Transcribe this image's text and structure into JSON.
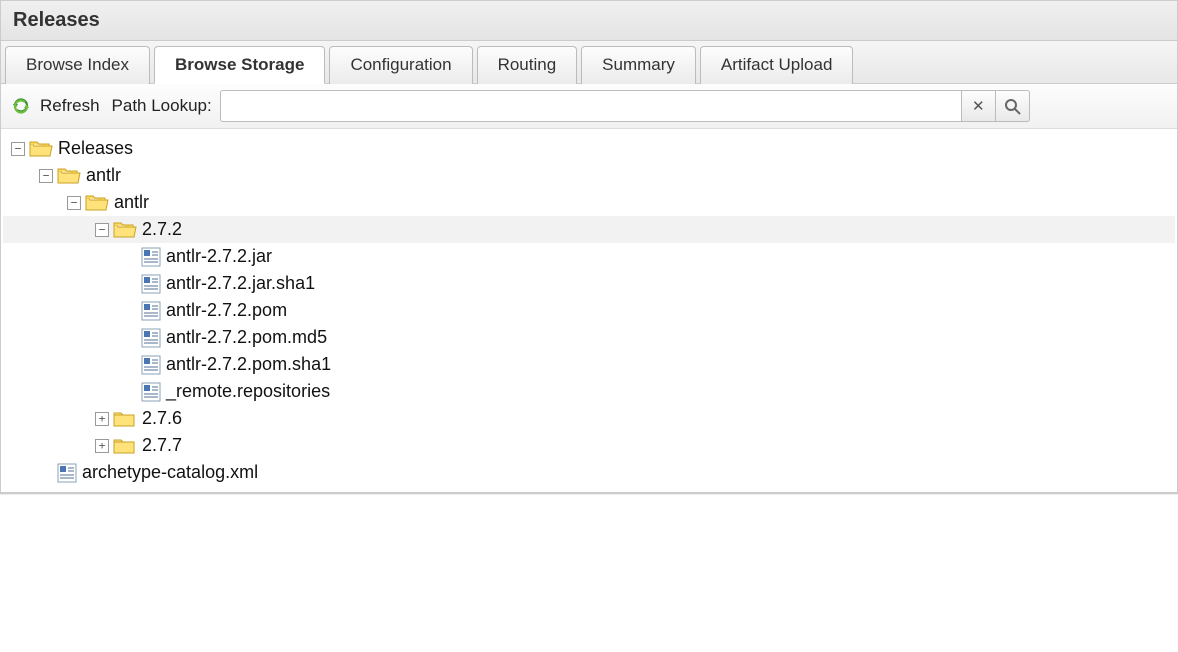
{
  "panel": {
    "title": "Releases"
  },
  "tabs": [
    {
      "label": "Browse Index",
      "active": false
    },
    {
      "label": "Browse Storage",
      "active": true
    },
    {
      "label": "Configuration",
      "active": false
    },
    {
      "label": "Routing",
      "active": false
    },
    {
      "label": "Summary",
      "active": false
    },
    {
      "label": "Artifact Upload",
      "active": false
    }
  ],
  "toolbar": {
    "refresh_label": "Refresh",
    "lookup_label": "Path Lookup:",
    "lookup_value": "",
    "lookup_placeholder": ""
  },
  "tree": [
    {
      "depth": 0,
      "type": "folder-open",
      "toggle": "minus",
      "label": "Releases",
      "selected": false
    },
    {
      "depth": 1,
      "type": "folder-open",
      "toggle": "minus",
      "label": "antlr",
      "selected": false
    },
    {
      "depth": 2,
      "type": "folder-open",
      "toggle": "minus",
      "label": "antlr",
      "selected": false
    },
    {
      "depth": 3,
      "type": "folder-open",
      "toggle": "minus",
      "label": "2.7.2",
      "selected": true
    },
    {
      "depth": 4,
      "type": "file",
      "toggle": "none",
      "label": "antlr-2.7.2.jar",
      "selected": false
    },
    {
      "depth": 4,
      "type": "file",
      "toggle": "none",
      "label": "antlr-2.7.2.jar.sha1",
      "selected": false
    },
    {
      "depth": 4,
      "type": "file",
      "toggle": "none",
      "label": "antlr-2.7.2.pom",
      "selected": false
    },
    {
      "depth": 4,
      "type": "file",
      "toggle": "none",
      "label": "antlr-2.7.2.pom.md5",
      "selected": false
    },
    {
      "depth": 4,
      "type": "file",
      "toggle": "none",
      "label": "antlr-2.7.2.pom.sha1",
      "selected": false
    },
    {
      "depth": 4,
      "type": "file",
      "toggle": "none",
      "label": "_remote.repositories",
      "selected": false
    },
    {
      "depth": 3,
      "type": "folder-closed",
      "toggle": "plus",
      "label": "2.7.6",
      "selected": false
    },
    {
      "depth": 3,
      "type": "folder-closed",
      "toggle": "plus",
      "label": "2.7.7",
      "selected": false
    },
    {
      "depth": 1,
      "type": "file",
      "toggle": "none",
      "label": "archetype-catalog.xml",
      "selected": false
    }
  ]
}
